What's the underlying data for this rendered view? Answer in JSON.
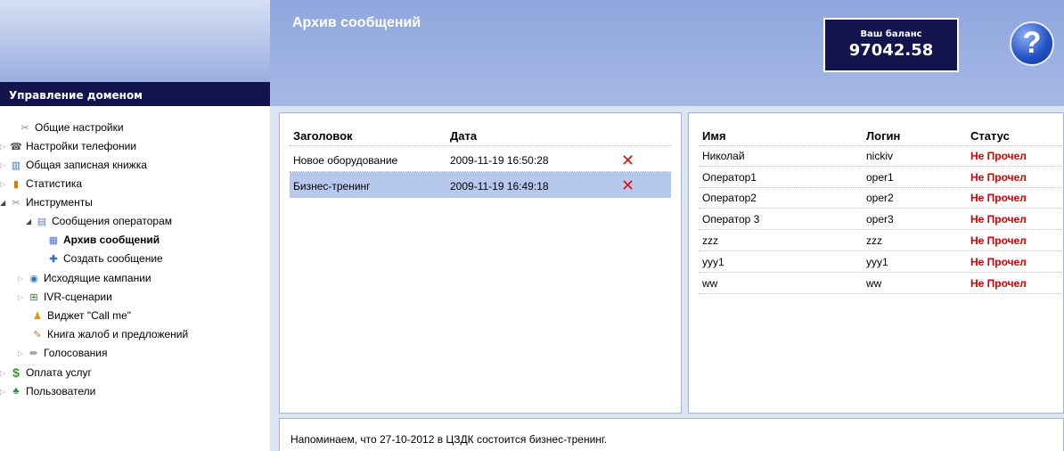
{
  "header": {
    "domain_title": "Управление доменом",
    "page_title": "Архив сообщений",
    "balance_label": "Ваш баланс",
    "balance_value": "97042.58",
    "help_icon": "question-icon",
    "help_label": "?"
  },
  "sidebar": {
    "items": [
      {
        "label": "Общие настройки",
        "icon": "tools-icon"
      },
      {
        "label": "Настройки телефонии",
        "icon": "phone-icon"
      },
      {
        "label": "Общая записная книжка",
        "icon": "book-icon"
      },
      {
        "label": "Статистика",
        "icon": "bar-chart-icon"
      },
      {
        "label": "Инструменты",
        "icon": "tools-icon"
      },
      {
        "label": "Сообщения операторам",
        "icon": "message-icon"
      },
      {
        "label": "Архив сообщений",
        "icon": "archive-icon"
      },
      {
        "label": "Создать сообщение",
        "icon": "plus-icon"
      },
      {
        "label": "Исходящие кампании",
        "icon": "globe-icon"
      },
      {
        "label": "IVR-сценарии",
        "icon": "tree-icon"
      },
      {
        "label": "Виджет \"Call me\"",
        "icon": "bell-icon"
      },
      {
        "label": "Книга жалоб и предложений",
        "icon": "notebook-icon"
      },
      {
        "label": "Голосования",
        "icon": "pencil-icon"
      },
      {
        "label": "Оплата услуг",
        "icon": "dollar-icon"
      },
      {
        "label": "Пользователи",
        "icon": "users-icon"
      }
    ]
  },
  "messages": {
    "headers": [
      "Заголовок",
      "Дата"
    ],
    "rows": [
      {
        "title": "Новое оборудование",
        "date": "2009-11-19 16:50:28"
      },
      {
        "title": "Бизнес-тренинг",
        "date": "2009-11-19 16:49:18"
      }
    ],
    "delete_icon": "close-icon",
    "delete_glyph": "✕"
  },
  "users": {
    "headers": [
      "Имя",
      "Логин",
      "Статус"
    ],
    "rows": [
      {
        "name": "Николай",
        "login": "nickiv",
        "status": "Не Прочел"
      },
      {
        "name": "Оператор1",
        "login": "oper1",
        "status": "Не Прочел"
      },
      {
        "name": "Оператор2",
        "login": "oper2",
        "status": "Не Прочел"
      },
      {
        "name": "Оператор 3",
        "login": "oper3",
        "status": "Не Прочел"
      },
      {
        "name": "zzz",
        "login": "zzz",
        "status": "Не Прочел"
      },
      {
        "name": "yyy1",
        "login": "yyy1",
        "status": "Не Прочел"
      },
      {
        "name": "ww",
        "login": "ww",
        "status": "Не Прочел"
      }
    ]
  },
  "footer": {
    "notice": "Напоминаем, что 27-10-2012 в ЦЗДК состоится бизнес-тренинг."
  },
  "colors": {
    "accent": "#13134d",
    "header_bg": "#9aaee0",
    "selected_row": "#b7c8ef",
    "status_red": "#d40000"
  }
}
